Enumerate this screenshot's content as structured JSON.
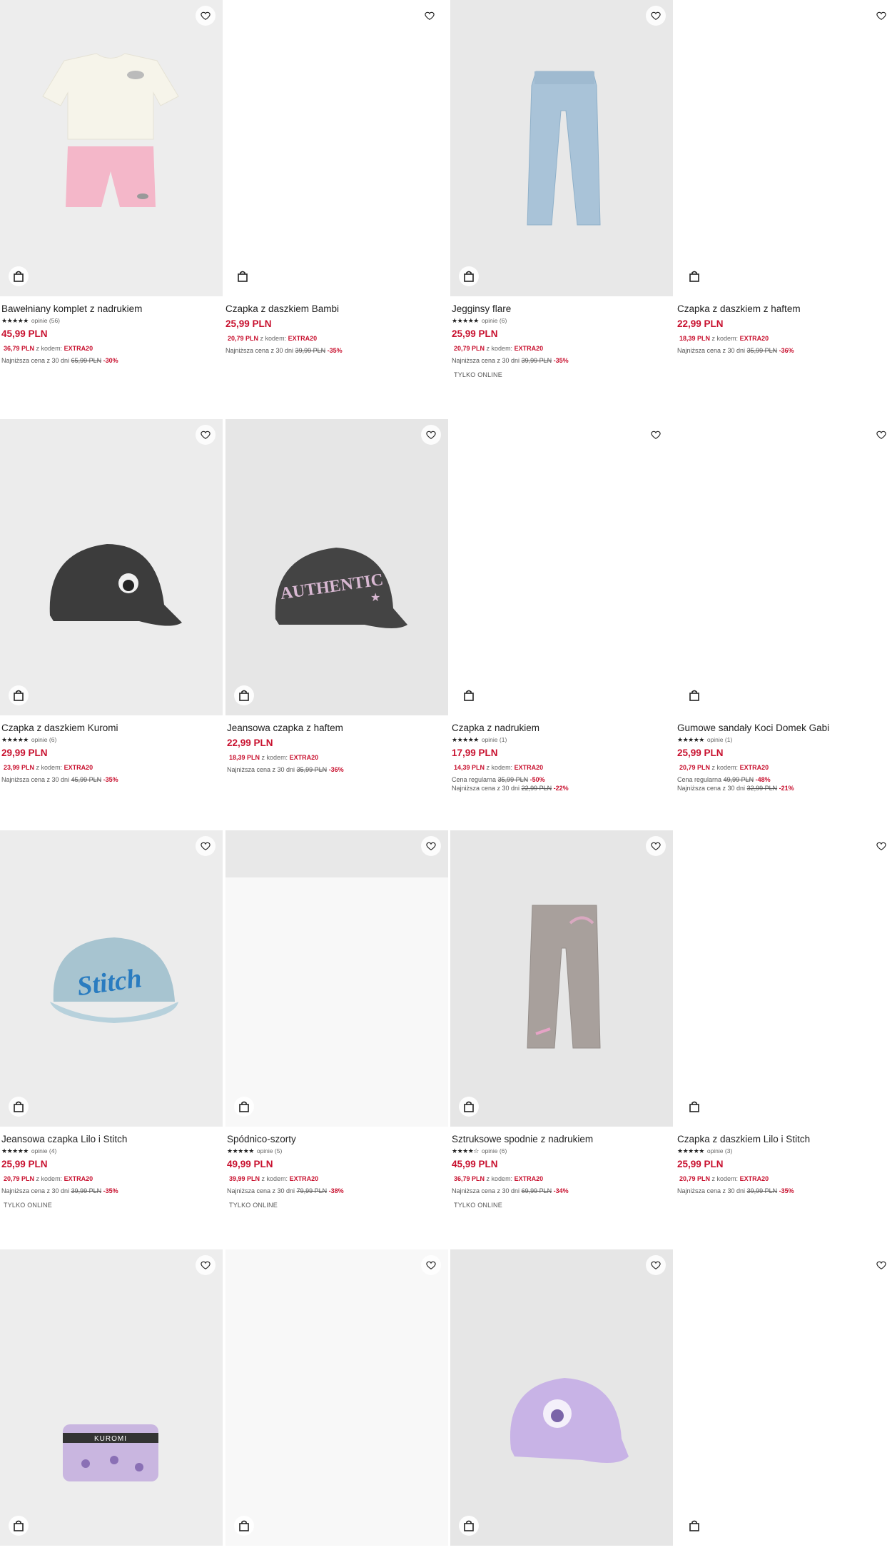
{
  "products": [
    {
      "title": "Bawełniany komplet z nadrukiem",
      "rating": "opinie (56)",
      "price": "45,99 PLN",
      "code_price": "36,79 PLN",
      "code_text": "z kodem:",
      "code": "EXTRA20",
      "lowest_text": "Najniższa cena z 30 dni",
      "lowest_price": "65,99 PLN",
      "lowest_pct": "-30%",
      "online": ""
    },
    {
      "title": "Czapka z daszkiem Bambi",
      "rating": "",
      "price": "25,99 PLN",
      "code_price": "20,79 PLN",
      "code_text": "z kodem:",
      "code": "EXTRA20",
      "lowest_text": "Najniższa cena z 30 dni",
      "lowest_price": "39,99 PLN",
      "lowest_pct": "-35%",
      "online": ""
    },
    {
      "title": "Jegginsy flare",
      "rating": "opinie (6)",
      "price": "25,99 PLN",
      "code_price": "20,79 PLN",
      "code_text": "z kodem:",
      "code": "EXTRA20",
      "lowest_text": "Najniższa cena z 30 dni",
      "lowest_price": "39,99 PLN",
      "lowest_pct": "-35%",
      "online": "TYLKO ONLINE"
    },
    {
      "title": "Czapka z daszkiem z haftem",
      "rating": "",
      "price": "22,99 PLN",
      "code_price": "18,39 PLN",
      "code_text": "z kodem:",
      "code": "EXTRA20",
      "lowest_text": "Najniższa cena z 30 dni",
      "lowest_price": "35,99 PLN",
      "lowest_pct": "-36%",
      "online": ""
    },
    {
      "title": "Czapka z daszkiem Kuromi",
      "rating": "opinie (6)",
      "price": "29,99 PLN",
      "code_price": "23,99 PLN",
      "code_text": "z kodem:",
      "code": "EXTRA20",
      "lowest_text": "Najniższa cena z 30 dni",
      "lowest_price": "45,99 PLN",
      "lowest_pct": "-35%",
      "online": ""
    },
    {
      "title": "Jeansowa czapka z haftem",
      "rating": "",
      "price": "22,99 PLN",
      "code_price": "18,39 PLN",
      "code_text": "z kodem:",
      "code": "EXTRA20",
      "lowest_text": "Najniższa cena z 30 dni",
      "lowest_price": "35,99 PLN",
      "lowest_pct": "-36%",
      "online": ""
    },
    {
      "title": "Czapka z nadrukiem",
      "rating": "opinie (1)",
      "price": "17,99 PLN",
      "code_price": "14,39 PLN",
      "code_text": "z kodem:",
      "code": "EXTRA20",
      "regular_text": "Cena regularna",
      "regular_price": "35,99 PLN",
      "regular_pct": "-50%",
      "lowest_text": "Najniższa cena z 30 dni",
      "lowest_price": "22,99 PLN",
      "lowest_pct": "-22%",
      "online": ""
    },
    {
      "title": "Gumowe sandały Koci Domek Gabi",
      "rating": "opinie (1)",
      "price": "25,99 PLN",
      "code_price": "20,79 PLN",
      "code_text": "z kodem:",
      "code": "EXTRA20",
      "regular_text": "Cena regularna",
      "regular_price": "49,99 PLN",
      "regular_pct": "-48%",
      "lowest_text": "Najniższa cena z 30 dni",
      "lowest_price": "32,99 PLN",
      "lowest_pct": "-21%",
      "online": ""
    },
    {
      "title": "Jeansowa czapka Lilo i Stitch",
      "rating": "opinie (4)",
      "price": "25,99 PLN",
      "code_price": "20,79 PLN",
      "code_text": "z kodem:",
      "code": "EXTRA20",
      "lowest_text": "Najniższa cena z 30 dni",
      "lowest_price": "39,99 PLN",
      "lowest_pct": "-35%",
      "online": "TYLKO ONLINE"
    },
    {
      "title": "Spódnico-szorty",
      "rating": "opinie (5)",
      "price": "49,99 PLN",
      "code_price": "39,99 PLN",
      "code_text": "z kodem:",
      "code": "EXTRA20",
      "lowest_text": "Najniższa cena z 30 dni",
      "lowest_price": "79,99 PLN",
      "lowest_pct": "-38%",
      "online": "TYLKO ONLINE"
    },
    {
      "title": "Sztruksowe spodnie z nadrukiem",
      "rating": "opinie (6)",
      "price": "45,99 PLN",
      "code_price": "36,79 PLN",
      "code_text": "z kodem:",
      "code": "EXTRA20",
      "lowest_text": "Najniższa cena z 30 dni",
      "lowest_price": "69,99 PLN",
      "lowest_pct": "-34%",
      "online": "TYLKO ONLINE"
    },
    {
      "title": "Czapka z daszkiem Lilo i Stitch",
      "rating": "opinie (3)",
      "price": "25,99 PLN",
      "code_price": "20,79 PLN",
      "code_text": "z kodem:",
      "code": "EXTRA20",
      "lowest_text": "Najniższa cena z 30 dni",
      "lowest_price": "39,99 PLN",
      "lowest_pct": "-35%",
      "online": ""
    }
  ],
  "stitch_text": "Stitch",
  "authentic_text": "AUTHENTIC",
  "kuromi_text": "KUROMI"
}
